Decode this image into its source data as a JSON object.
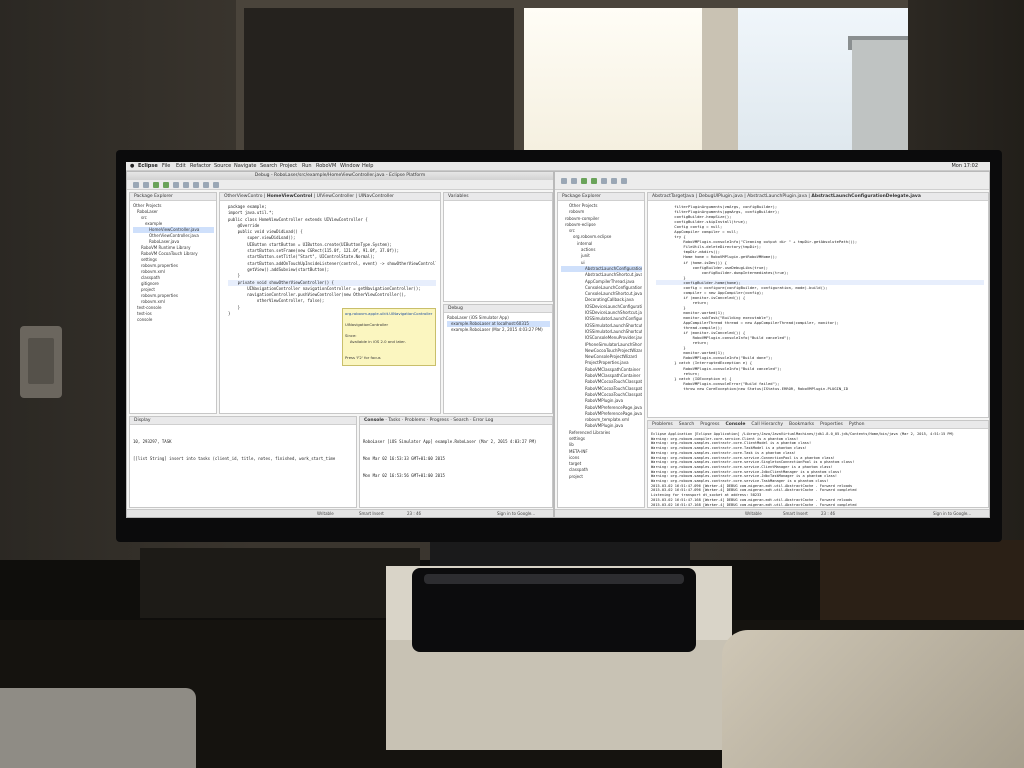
{
  "menubar": {
    "items": [
      "Eclipse",
      "File",
      "Edit",
      "Refactor",
      "Source",
      "Navigate",
      "Search",
      "Project",
      "Run",
      "RoboVM",
      "Window",
      "Help"
    ],
    "clock": "Mon 17:02"
  },
  "left_window": {
    "title": "Debug - RoboLaser/src/example/HomeViewController.java - Eclipse Platform",
    "explorer_tab": "Package Explorer",
    "explorer_items": [
      "Other Projects",
      "RoboLaser",
      "src",
      "example",
      "HomeViewController.java",
      "OtherViewController.java",
      "RoboLaser.java",
      "RoboVM Runtime Library",
      "RoboVM CocoaTouch Library",
      "settings",
      "robovm.properties",
      "robovm.xml",
      "classpath",
      "gitignore",
      "project",
      "robovm.properties",
      "robovm.xml",
      "test-console",
      "test-ios",
      "console"
    ],
    "editor_tabs": [
      "OtherViewContro",
      "HomeViewControl",
      "UIViewController",
      "UINavController"
    ],
    "code_lines": [
      "package example;",
      "",
      "import java.util.*;",
      "",
      "public class HomeViewController extends UIViewController {",
      "",
      "    @Override",
      "    public void viewDidLoad() {",
      "        super.viewDidLoad();",
      "        UIButton startButton = UIButton.create(UIButtonType.System);",
      "        startButton.setFrame(new CGRect(115.0f, 121.0f, 91.0f, 37.0f));",
      "        startButton.setTitle(\"Start\", UIControlState.Normal);",
      "        startButton.addOnTouchUpInsideListener(control, event) -> showOtherViewController",
      "        getView().addSubview(startButton);",
      "    }",
      "",
      "    private void showOtherViewController() {",
      "        UINavigationController navigationController = getNavigationController();",
      "        navigationController.pushViewController(new OtherViewController(),",
      "            otherViewController, false);",
      "    }",
      "}"
    ],
    "tooltip_lines": [
      "org.robovm.apple.uikit.UINavigationController",
      "",
      "UINavigationController",
      "",
      "Since:",
      "    Available in iOS 2.0 and later.",
      "",
      "",
      "Press 'F2' for focus"
    ],
    "outline_tab": "Variables",
    "debug_tab": "Debug",
    "debug_items": [
      "RoboLaser (iOS Simulator App)",
      "example.RoboLaser at localhost:60315",
      "example.RoboLaser (Mar 2, 2015 4:03:27 PM)"
    ],
    "console_tab": "Display",
    "console_tabs2": [
      "Console",
      "Tasks",
      "Problems",
      "Progress",
      "Search",
      "Error Log"
    ],
    "console_left_lines": [
      "10, 293297, TASK",
      "[[list String] insert into tasks (client_id, title, notes, finished, work_start_time"
    ],
    "console_right_lines": [
      "RoboLaser [iOS Simulator App] example.RoboLaser (Mar 2, 2015 4:03:27 PM)",
      "Mon Mar 02 16:53:33 GMT+01:00 2015",
      "Mon Mar 02 16:53:56 GMT+01:00 2015"
    ],
    "status_writable": "Writable",
    "status_insert": "Smart Insert",
    "status_pos": "23 : 46",
    "status_sign": "Sign in to Google..."
  },
  "right_window": {
    "explorer_tab": "Package Explorer",
    "explorer_items": [
      "Other Projects",
      "robovm",
      "robovm-compiler",
      "robovm-eclipse",
      "src",
      "org.robovm.eclipse",
      "internal",
      "actions",
      "junit",
      "ui",
      "AbstractLaunchConfiguration",
      "AbstractLaunchShortcut.java",
      "AppCompilerThread.java",
      "ConsoleLaunchConfiguration",
      "ConsoleLaunchShortcut.java",
      "DecoratingCallback.java",
      "IOSDeviceLaunchConfiguration",
      "IOSDeviceLaunchShortcut.java",
      "IOSSimulatorLaunchConfiguration",
      "IOSSimulatorLaunchShortcut.java",
      "IOSSimulatorLaunchShortcut",
      "IOSConsoleMenuProvider.java",
      "IPhoneSimulatorLaunchShortcut",
      "NewCocoaTouchProjectWizard",
      "NewConsoleProjectWizard",
      "ProjectProperties.java",
      "RoboVMClasspathContainer",
      "RoboVMClasspathContainer",
      "RoboVMCocoaTouchClasspath",
      "RoboVMCocoaTouchClasspath",
      "RoboVMCocoaTouchClasspath",
      "RoboVMPlugin.java",
      "RoboVMPreferencePage.java",
      "RoboVMPreferencePage.java",
      "robovm_template.xml",
      "RoboVMPlugin.java",
      "Referenced Libraries",
      "settings",
      "lib",
      "META-INF",
      "icons",
      "target",
      "classpath",
      "project"
    ],
    "editor_tabs": [
      "AbstractTargetJava",
      "DebugUIPlugin.java",
      "AbstractLaunchPlugin.java",
      "AbstractLaunchConfigurationDelegate.java"
    ],
    "code_lines": [
      "        filterPluginArguments(vmArgs, configBuilder);",
      "        filterPluginArguments(pgmArgs, configBuilder);",
      "",
      "        configBuilder.heapSize();",
      "        configBuilder.skipInstall(true);",
      "",
      "        Config config = null;",
      "        AppCompiler compiler = null;",
      "        try {",
      "            RoboVMPlugin.consoleInfo(\"Cleaning output dir \" + tmpDir.getAbsolutePath());",
      "            FileUtils.deleteDirectory(tmpDir);",
      "            tmpDir.mkdirs();",
      "",
      "            Home home = RoboVMPlugin.getRoboVMHome();",
      "            if (home.isDev()) {",
      "                configBuilder.useDebugLibs(true);",
      "                    configBuilder.dumpIntermediates(true);",
      "            }",
      "            configBuilder.home(home);",
      "            config = configure(configBuilder, configuration, mode).build();",
      "            compiler = new AppCompiler(config);",
      "            if (monitor.isCanceled()) {",
      "                return;",
      "            }",
      "            monitor.worked(1);",
      "",
      "            monitor.subTask(\"Building executable\");",
      "            AppCompilerThread thread = new AppCompilerThread(compiler, monitor);",
      "            thread.compile();",
      "            if (monitor.isCanceled()) {",
      "                RoboVMPlugin.consoleInfo(\"Build canceled\");",
      "                return;",
      "            }",
      "            monitor.worked(1);",
      "            RoboVMPlugin.consoleInfo(\"Build done\");",
      "        } catch (InterruptedException e) {",
      "            RoboVMPlugin.consoleInfo(\"Build canceled\");",
      "            return;",
      "        } catch (IOException e) {",
      "            RoboVMPlugin.consoleError(\"Build failed\");",
      "            throw new CoreException(new Status(IStatus.ERROR, RoboVMPlugin.PLUGIN_ID"
    ],
    "console_tabs": [
      "Problems",
      "Search",
      "Progress",
      "Console",
      "Call Hierarchy",
      "Bookmarks",
      "Properties",
      "Python"
    ],
    "console_lines": [
      "Eclipse Application [Eclipse Application] /Library/Java/JavaVirtualMachines/jdk1.8.0_05.jdk/Contents/Home/bin/java (Mar 2, 2015, 4:51:15 PM)",
      "Warning: org.robovm.compiler.core.service.Client is a phantom class!",
      "Warning: org.robovm.samples.contractr.core.ClientModel is a phantom class!",
      "Warning: org.robovm.samples.contractr.core.TaskModel is a phantom class!",
      "Warning: org.robovm.samples.contractr.core.Task is a phantom class!",
      "Warning: org.robovm.samples.contractr.core.service.ConnectionPool is a phantom class!",
      "Warning: org.robovm.samples.contractr.core.service.SingletonConnectionPool is a phantom class!",
      "Warning: org.robovm.samples.contractr.core.service.ClientManager is a phantom class!",
      "Warning: org.robovm.samples.contractr.core.service.JdbcClientManager is a phantom class!",
      "Warning: org.robovm.samples.contractr.core.service.JdbcTaskManager is a phantom class!",
      "Warning: org.robovm.samples.contractr.core.service.TaskManager is a phantom class!",
      "2015-03-02 16:51:47.096 [Worker-4] DEBUG com.migeran.mdt.util.AbstractCache - Forward reloads",
      "2015-03-02 16:51:47.096 [Worker-4] DEBUG com.migeran.mdt.util.AbstractCache - Forward completed",
      "Listening for transport dt_socket at address: 58233",
      "2015-03-02 16:51:47.168 [Worker-4] DEBUG com.migeran.mdt.util.AbstractCache - Forward reloads",
      "2015-03-02 16:51:47.168 [Worker-4] DEBUG com.migeran.mdt.util.AbstractCache - Forward completed"
    ],
    "status_writable": "Writable",
    "status_insert": "Smart Insert",
    "status_pos": "23 : 46",
    "status_sign": "Sign in to Google..."
  }
}
